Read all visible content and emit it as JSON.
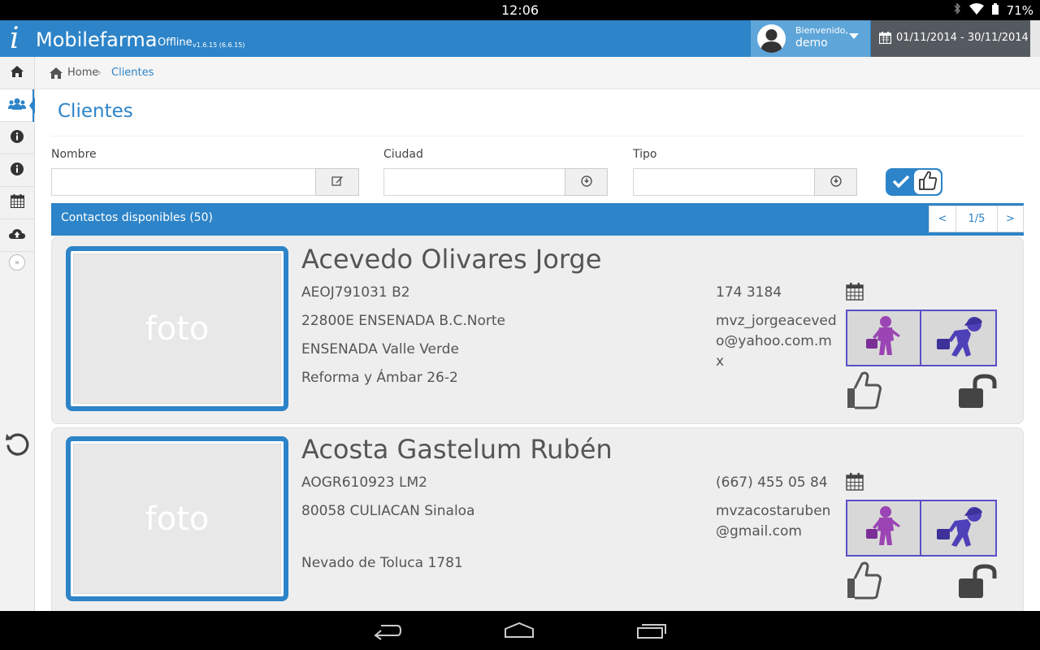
{
  "status_bar": {
    "time": "12:06",
    "battery": "71%"
  },
  "header": {
    "brand_i": "i",
    "brand_name": "Mobilefarma",
    "offline_label": "Offline",
    "version": "v1.6.15 (6.6.15)",
    "welcome_label": "Bienvenido,",
    "username": "demo",
    "date_range": "01/11/2014 - 30/11/2014",
    "brand_color": "#2d84c8"
  },
  "sidebar": {
    "items": [
      {
        "icon": "home-icon"
      },
      {
        "icon": "users-icon",
        "active": true
      },
      {
        "icon": "info-icon"
      },
      {
        "icon": "info-icon"
      },
      {
        "icon": "calendar-icon"
      },
      {
        "icon": "cloud-upload-icon"
      }
    ]
  },
  "breadcrumb": {
    "home": "Home",
    "current": "Clientes"
  },
  "page": {
    "title": "Clientes"
  },
  "filters": {
    "nombre_label": "Nombre",
    "ciudad_label": "Ciudad",
    "tipo_label": "Tipo",
    "nombre_value": "",
    "ciudad_value": "",
    "tipo_value": ""
  },
  "contacts": {
    "title": "Contactos disponibles (50)",
    "pager": {
      "prev": "<",
      "page": "1/5",
      "next": ">"
    },
    "items": [
      {
        "name": "Acevedo Olivares Jorge",
        "rfc": "AEOJ791031 B2",
        "line2": "22800E ENSENADA B.C.Norte",
        "line3": "ENSENADA Valle Verde",
        "line4": "Reforma y Ámbar 26-2",
        "phone": "174 3184",
        "email": "mvz_jorgeacevedo@yahoo.com.mx",
        "photo_placeholder": "foto"
      },
      {
        "name": "Acosta Gastelum Rubén",
        "rfc": "AOGR610923 LM2",
        "line2": "80058 CULIACAN Sinaloa",
        "line3": "",
        "line4": "Nevado de Toluca 1781",
        "phone": "(667) 455 05 84",
        "email": "mvzacostaruben@gmail.com",
        "photo_placeholder": "foto"
      }
    ]
  }
}
